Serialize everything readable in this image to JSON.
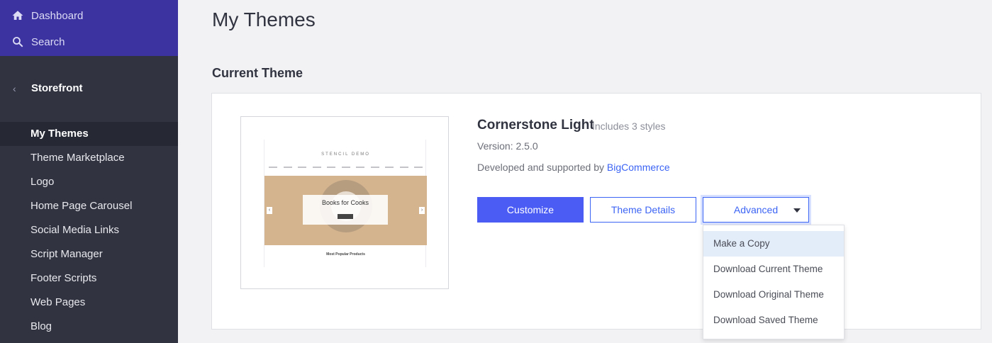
{
  "sidebar": {
    "top_nav": [
      {
        "label": "Dashboard",
        "icon": "home-icon"
      },
      {
        "label": "Search",
        "icon": "search-icon"
      }
    ],
    "back_label": "Storefront",
    "items": [
      {
        "label": "My Themes",
        "active": true
      },
      {
        "label": "Theme Marketplace"
      },
      {
        "label": "Logo"
      },
      {
        "label": "Home Page Carousel"
      },
      {
        "label": "Social Media Links"
      },
      {
        "label": "Script Manager"
      },
      {
        "label": "Footer Scripts"
      },
      {
        "label": "Web Pages"
      },
      {
        "label": "Blog"
      }
    ]
  },
  "main": {
    "page_title": "My Themes",
    "section_title": "Current Theme",
    "theme": {
      "name": "Cornerstone Light",
      "styles": "Includes 3 styles",
      "version": "Version: 2.5.0",
      "developed_prefix": "Developed and supported by",
      "developer_link": "BigCommerce",
      "preview": {
        "brand": "STENCIL DEMO",
        "hero_text": "Books for Cooks",
        "popular": "Most Popular Products"
      }
    },
    "buttons": {
      "customize": "Customize",
      "details": "Theme Details",
      "advanced": "Advanced"
    },
    "advanced_menu": [
      "Make a Copy",
      "Download Current Theme",
      "Download Original Theme",
      "Download Saved Theme"
    ]
  },
  "colors": {
    "sidebar_bg": "#313440",
    "sidebar_top": "#3c32a0",
    "accent": "#4b5cf5",
    "link": "#3c64f4"
  }
}
